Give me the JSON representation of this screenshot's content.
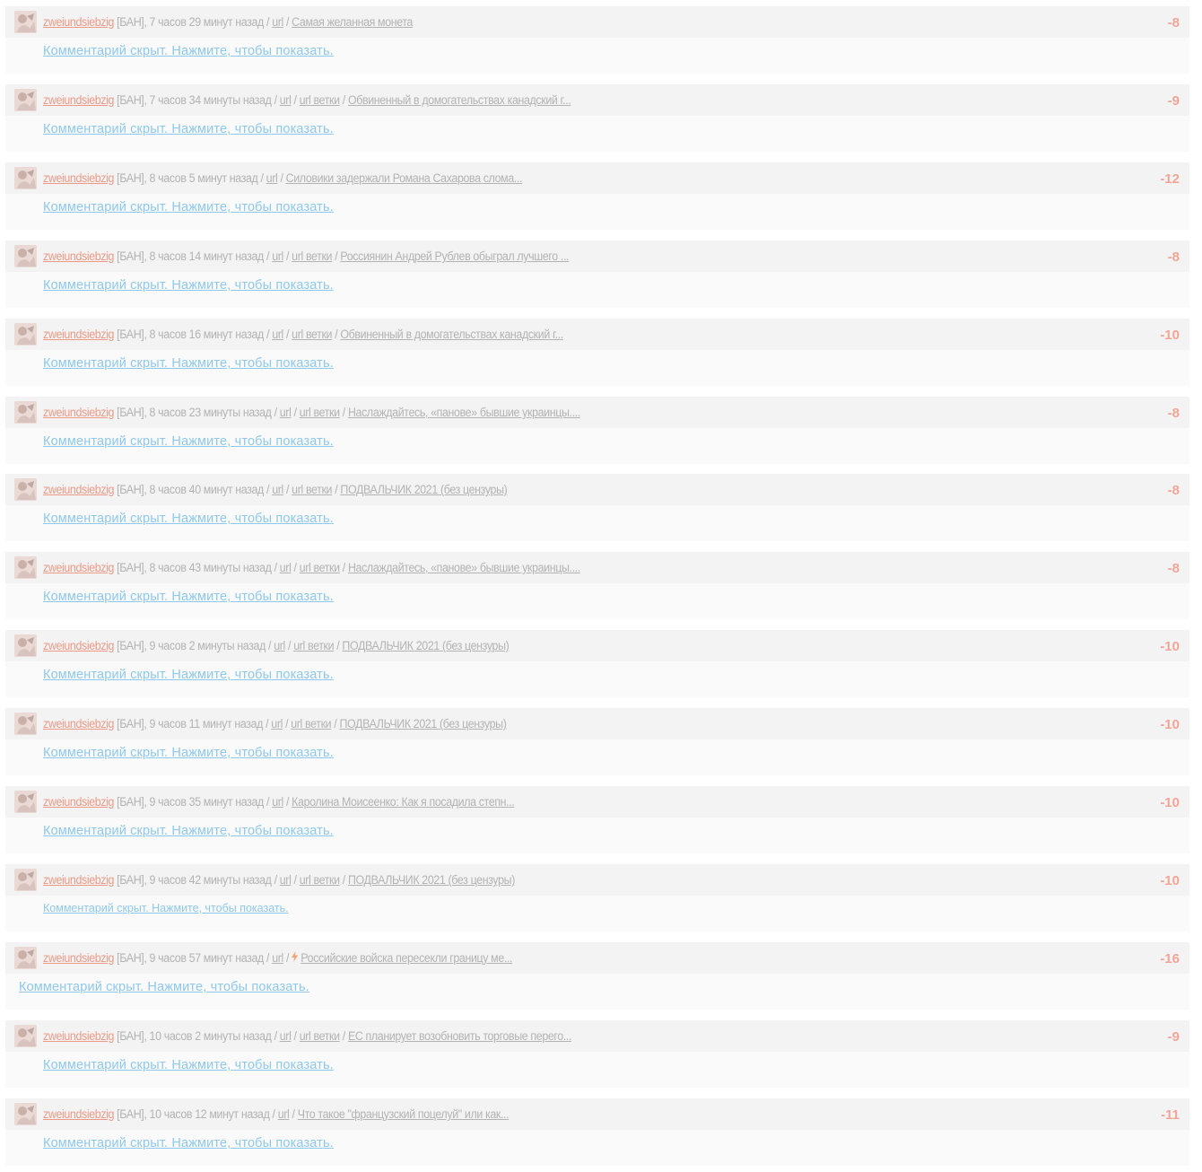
{
  "comments": [
    {
      "user": "zweiundsiebzig",
      "status": "[БАН]",
      "time": "7 часов 29 минут назад",
      "url": "url",
      "thread": "",
      "bolt": false,
      "title": "Самая желанная монета",
      "score": "-8",
      "hidden_text": "Комментарий скрыт. Нажмите, чтобы показать."
    },
    {
      "user": "zweiundsiebzig",
      "status": "[БАН]",
      "time": "7 часов 34 минуты назад",
      "url": "url",
      "thread": "url ветки",
      "bolt": false,
      "title": "Обвиненный в домогательствах канадский г...",
      "score": "-9",
      "hidden_text": "Комментарий скрыт. Нажмите, чтобы показать."
    },
    {
      "user": "zweiundsiebzig",
      "status": "[БАН]",
      "time": "8 часов 5 минут назад",
      "url": "url",
      "thread": "",
      "bolt": false,
      "title": "Силовики задержали Романа Сахарова слома...",
      "score": "-12",
      "hidden_text": "Комментарий скрыт. Нажмите, чтобы показать."
    },
    {
      "user": "zweiundsiebzig",
      "status": "[БАН]",
      "time": "8 часов 14 минут назад",
      "url": "url",
      "thread": "url ветки",
      "bolt": false,
      "title": "Россиянин Андрей Рублев обыграл лучшего ...",
      "score": "-8",
      "hidden_text": "Комментарий скрыт. Нажмите, чтобы показать."
    },
    {
      "user": "zweiundsiebzig",
      "status": "[БАН]",
      "time": "8 часов 16 минут назад",
      "url": "url",
      "thread": "url ветки",
      "bolt": false,
      "title": "Обвиненный в домогательствах канадский г...",
      "score": "-10",
      "hidden_text": "Комментарий скрыт. Нажмите, чтобы показать."
    },
    {
      "user": "zweiundsiebzig",
      "status": "[БАН]",
      "time": "8 часов 23 минуты назад",
      "url": "url",
      "thread": "url ветки",
      "bolt": false,
      "title": "Наслаждайтесь, «панове» бывшие украинцы....",
      "score": "-8",
      "hidden_text": "Комментарий скрыт. Нажмите, чтобы показать."
    },
    {
      "user": "zweiundsiebzig",
      "status": "[БАН]",
      "time": "8 часов 40 минут назад",
      "url": "url",
      "thread": "url ветки",
      "bolt": false,
      "title": "ПОДВАЛЬЧИК 2021 (без цензуры)",
      "score": "-8",
      "hidden_text": "Комментарий скрыт. Нажмите, чтобы показать."
    },
    {
      "user": "zweiundsiebzig",
      "status": "[БАН]",
      "time": "8 часов 43 минуты назад",
      "url": "url",
      "thread": "url ветки",
      "bolt": false,
      "title": "Наслаждайтесь, «панове» бывшие украинцы....",
      "score": "-8",
      "hidden_text": "Комментарий скрыт. Нажмите, чтобы показать."
    },
    {
      "user": "zweiundsiebzig",
      "status": "[БАН]",
      "time": "9 часов 2 минуты назад",
      "url": "url",
      "thread": "url ветки",
      "bolt": false,
      "title": "ПОДВАЛЬЧИК 2021 (без цензуры)",
      "score": "-10",
      "hidden_text": "Комментарий скрыт. Нажмите, чтобы показать."
    },
    {
      "user": "zweiundsiebzig",
      "status": "[БАН]",
      "time": "9 часов 11 минут назад",
      "url": "url",
      "thread": "url ветки",
      "bolt": false,
      "title": "ПОДВАЛЬЧИК 2021 (без цензуры)",
      "score": "-10",
      "hidden_text": "Комментарий скрыт. Нажмите, чтобы показать."
    },
    {
      "user": "zweiundsiebzig",
      "status": "[БАН]",
      "time": "9 часов 35 минут назад",
      "url": "url",
      "thread": "",
      "bolt": false,
      "title": "Каролина Моисеенко: Как я посадила степн...",
      "score": "-10",
      "hidden_text": "Комментарий скрыт. Нажмите, чтобы показать."
    },
    {
      "user": "zweiundsiebzig",
      "status": "[БАН]",
      "time": "9 часов 42 минуты назад",
      "url": "url",
      "thread": "url ветки",
      "bolt": false,
      "title": "ПОДВАЛЬЧИК 2021 (без цензуры)",
      "score": "-10",
      "hidden_text": "Комментарий скрыт. Нажмите, чтобы показать."
    },
    {
      "user": "zweiundsiebzig",
      "status": "[БАН]",
      "time": "9 часов 57 минут назад",
      "url": "url",
      "thread": "",
      "bolt": true,
      "title": "Российские войска пересекли границу ме...",
      "score": "-16",
      "hidden_text": "Комментарий скрыт. Нажмите, чтобы показать."
    },
    {
      "user": "zweiundsiebzig",
      "status": "[БАН]",
      "time": "10 часов 2 минуты назад",
      "url": "url",
      "thread": "url ветки",
      "bolt": false,
      "title": "ЕС планирует возобновить торговые перего...",
      "score": "-9",
      "hidden_text": "Комментарий скрыт. Нажмите, чтобы показать."
    },
    {
      "user": "zweiundsiebzig",
      "status": "[БАН]",
      "time": "10 часов 12 минут назад",
      "url": "url",
      "thread": "",
      "bolt": false,
      "title": "Что такое \"французский поцелуй\" или как...",
      "score": "-11",
      "hidden_text": "Комментарий скрыт. Нажмите, чтобы показать."
    }
  ],
  "colors": {
    "username": "#ec9a87",
    "score": "#f2a597",
    "hidden_link": "#8ec8ec",
    "meta": "#b3b3b3",
    "bolt": "#f3a679"
  },
  "icons": {
    "avatar": "avatar-icon",
    "bolt": "lightning-bolt-icon"
  }
}
